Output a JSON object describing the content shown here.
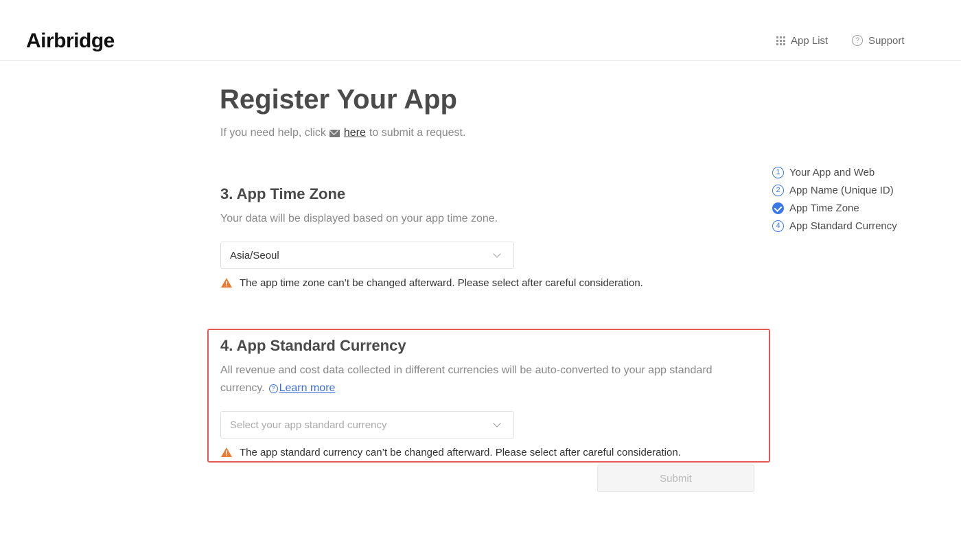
{
  "header": {
    "logo": "Airbridge",
    "nav": {
      "app_list": "App List",
      "support": "Support"
    }
  },
  "page": {
    "title": "Register Your App",
    "help": {
      "prefix": "If you need help, click",
      "link": "here",
      "suffix": "to submit a request."
    }
  },
  "time_zone": {
    "title": "3. App Time Zone",
    "description": "Your data will be displayed based on your app time zone.",
    "selected": "Asia/Seoul",
    "warning": "The app time zone can’t be changed afterward. Please select after careful consideration."
  },
  "currency": {
    "title": "4. App Standard Currency",
    "description_line1": "All revenue and cost data collected in different currencies will be auto-converted to your app standard",
    "description_line2": "currency.",
    "learn_more": "Learn more",
    "placeholder": "Select your app standard currency",
    "warning": "The app standard currency can’t be changed afterward. Please select after careful consideration."
  },
  "submit_label": "Submit",
  "steps": [
    {
      "number": "1",
      "label": "Your App and Web",
      "completed": false
    },
    {
      "number": "2",
      "label": "App Name (Unique ID)",
      "completed": false
    },
    {
      "number": "3",
      "label": "App Time Zone",
      "completed": true
    },
    {
      "number": "4",
      "label": "App Standard Currency",
      "completed": false
    }
  ],
  "colors": {
    "accent": "#3b78e7",
    "warning": "#ec7a32",
    "highlight": "#e55757",
    "link": "#3b6fe0"
  },
  "icons": {
    "app_list": "grid-icon",
    "support": "help-circle-icon",
    "help": "mail-icon",
    "learn_more": "question-circle-icon",
    "warning": "warning-triangle-icon",
    "dropdown": "chevron-down-icon",
    "step_done": "check-circle-icon"
  }
}
